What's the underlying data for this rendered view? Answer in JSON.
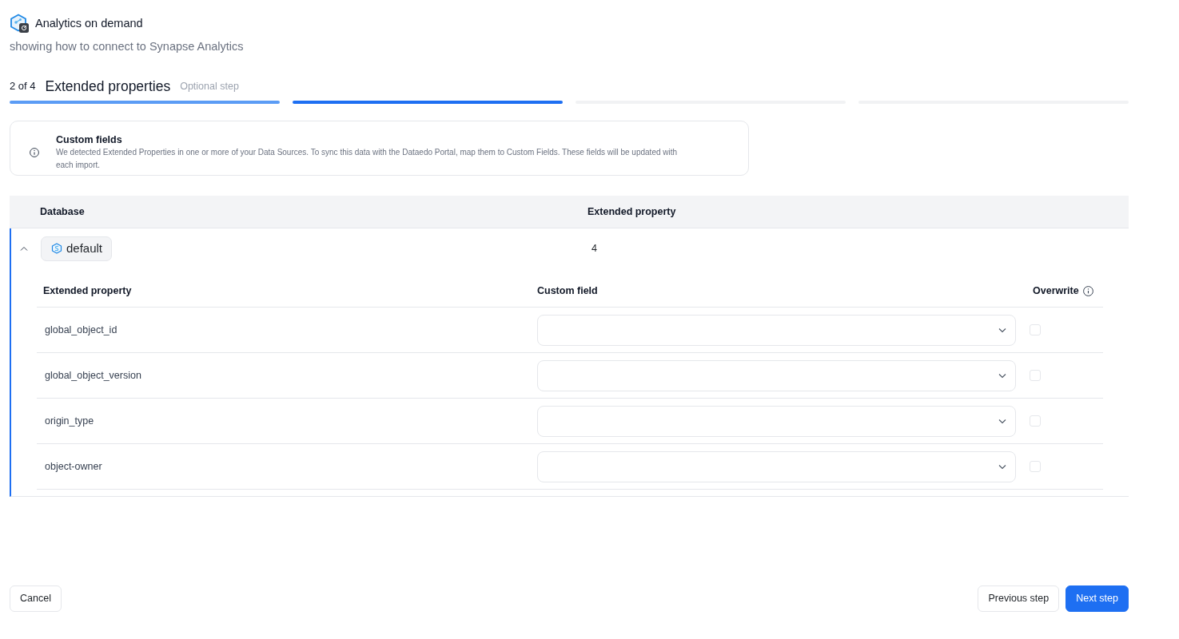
{
  "app": {
    "title": "Analytics on demand",
    "subtitle": "showing how to connect to Synapse Analytics"
  },
  "wizard": {
    "step_counter": "2 of 4",
    "step_title": "Extended properties",
    "step_note": "Optional step",
    "segments": [
      {
        "completed": true,
        "selected": false
      },
      {
        "completed": false,
        "selected": true
      },
      {
        "completed": false,
        "selected": false
      },
      {
        "completed": false,
        "selected": false
      }
    ]
  },
  "info_card": {
    "title": "Custom fields",
    "text": "We detected Extended Properties in one or more of your Data Sources. To sync this data with the Dataedo Portal, map them to Custom Fields. These fields will be updated with each import."
  },
  "table": {
    "columns": [
      "Database",
      "Extended property"
    ],
    "groups": [
      {
        "database": "default",
        "count": "4",
        "expanded": true,
        "columns": [
          "Extended property",
          "Custom field",
          "Overwrite"
        ],
        "rows": [
          {
            "property": "global_object_id",
            "overwrite": false
          },
          {
            "property": "global_object_version",
            "overwrite": false
          },
          {
            "property": "origin_type",
            "overwrite": false
          },
          {
            "property": "object-owner",
            "overwrite": false
          }
        ]
      }
    ]
  },
  "footer": {
    "left_buttons": [
      {
        "label": "Cancel",
        "kind": "outline"
      }
    ],
    "right_buttons": [
      {
        "label": "Previous step",
        "kind": "outline"
      },
      {
        "label": "Next step",
        "kind": "primary"
      }
    ]
  }
}
